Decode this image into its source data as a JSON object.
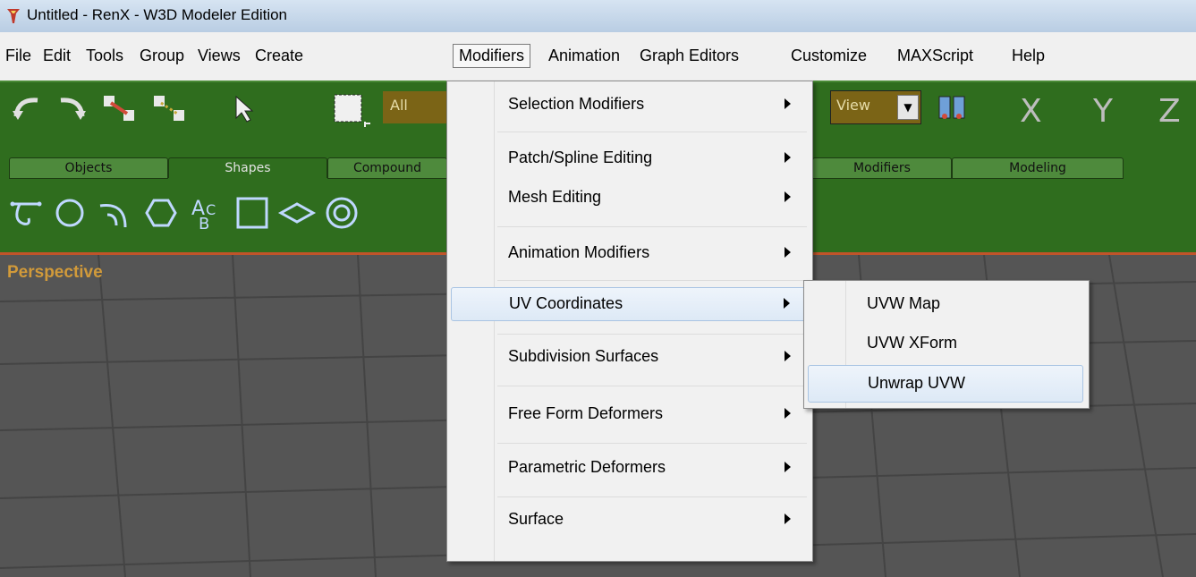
{
  "window": {
    "title": "Untitled - RenX - W3D Modeler Edition",
    "icon": "renx-app-icon"
  },
  "menubar": {
    "items": [
      "File",
      "Edit",
      "Tools",
      "Group",
      "Views",
      "Create",
      "Modifiers",
      "Animation",
      "Graph Editors",
      "Customize",
      "MAXScript",
      "Help"
    ],
    "active": "Modifiers"
  },
  "toolbar": {
    "selection_filter": "All",
    "reference_coord": "View",
    "axes": [
      "X",
      "Y",
      "Z"
    ],
    "icons": [
      "undo-icon",
      "redo-icon",
      "link-icon",
      "unlink-icon",
      "select-arrow-icon",
      "region-select-icon",
      "mirror-icon"
    ]
  },
  "command_tabs": {
    "items": [
      "Objects",
      "Shapes",
      "Compound",
      "Modifiers",
      "Modeling"
    ],
    "selected": "Shapes"
  },
  "shape_tools": [
    "line-icon",
    "circle-icon",
    "arc-icon",
    "ngon-icon",
    "text-icon",
    "rectangle-icon",
    "ellipse-icon",
    "donut-icon"
  ],
  "viewport": {
    "label": "Perspective"
  },
  "modifiers_menu": {
    "items": [
      {
        "label": "Selection Modifiers",
        "submenu": true
      },
      {
        "label": "Patch/Spline Editing",
        "submenu": true
      },
      {
        "label": "Mesh Editing",
        "submenu": true
      },
      {
        "label": "Animation Modifiers",
        "submenu": true
      },
      {
        "label": "UV Coordinates",
        "submenu": true
      },
      {
        "label": "Subdivision Surfaces",
        "submenu": true
      },
      {
        "label": "Free Form Deformers",
        "submenu": true
      },
      {
        "label": "Parametric Deformers",
        "submenu": true
      },
      {
        "label": "Surface",
        "submenu": true
      }
    ],
    "highlighted": "UV Coordinates"
  },
  "uv_submenu": {
    "items": [
      "UVW Map",
      "UVW XForm",
      "Unwrap UVW"
    ],
    "highlighted": "Unwrap UVW"
  },
  "colors": {
    "toolbar_green": "#2f6d1e",
    "field_brown": "#7b6416",
    "viewport_gray": "#555555",
    "label_orange": "#d19a3a",
    "menu_highlight": "#dde9f6"
  }
}
